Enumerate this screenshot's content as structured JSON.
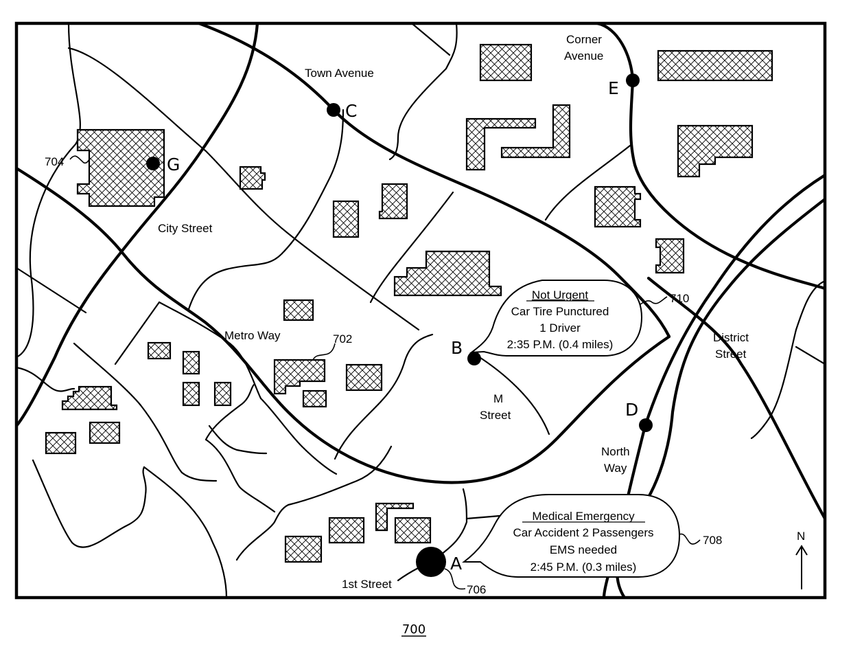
{
  "figure": {
    "number": "700",
    "north_label": "N"
  },
  "streets": {
    "town_avenue": "Town Avenue",
    "corner_avenue_1": "Corner",
    "corner_avenue_2": "Avenue",
    "city_street": "City Street",
    "metro_way": "Metro Way",
    "m_street_1": "M",
    "m_street_2": "Street",
    "district_street_1": "District",
    "district_street_2": "Street",
    "north_way_1": "North",
    "north_way_2": "Way",
    "first_street": "1st Street"
  },
  "points": {
    "a": "A",
    "b": "B",
    "c": "C",
    "d": "D",
    "e": "E",
    "g": "G"
  },
  "references": {
    "building": "702",
    "building_g": "704",
    "user_location": "706",
    "callout_a": "708",
    "callout_b": "710"
  },
  "callouts": {
    "b": {
      "title": "Not Urgent",
      "line1": "Car Tire Punctured",
      "line2": "1 Driver",
      "line3": "2:35 P.M. (0.4 miles)"
    },
    "a": {
      "title": "Medical Emergency",
      "line1": "Car Accident 2 Passengers",
      "line2": "EMS needed",
      "line3": "2:45 P.M. (0.3 miles)"
    }
  }
}
